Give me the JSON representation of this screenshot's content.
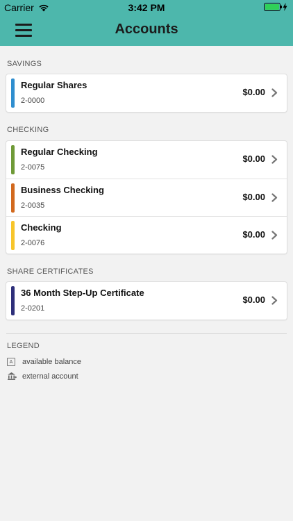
{
  "status_bar": {
    "carrier": "Carrier",
    "time": "3:42 PM"
  },
  "header": {
    "title": "Accounts",
    "menu_icon": "hamburger-icon"
  },
  "sections": [
    {
      "label": "SAVINGS",
      "accounts": [
        {
          "name": "Regular Shares",
          "number": "2-0000",
          "balance": "$0.00",
          "color": "#2f8ecf"
        }
      ]
    },
    {
      "label": "CHECKING",
      "accounts": [
        {
          "name": "Regular Checking",
          "number": "2-0075",
          "balance": "$0.00",
          "color": "#6f9a37"
        },
        {
          "name": "Business Checking",
          "number": "2-0035",
          "balance": "$0.00",
          "color": "#d2691e"
        },
        {
          "name": "Checking",
          "number": "2-0076",
          "balance": "$0.00",
          "color": "#f7c52b"
        }
      ]
    },
    {
      "label": "SHARE CERTIFICATES",
      "accounts": [
        {
          "name": "36 Month Step-Up Certificate",
          "number": "2-0201",
          "balance": "$0.00",
          "color": "#2e2f7a"
        }
      ]
    }
  ],
  "legend": {
    "label": "LEGEND",
    "items": [
      {
        "icon": "available-balance-icon",
        "glyph": "A",
        "text": "available balance"
      },
      {
        "icon": "bank-icon",
        "text": "external account"
      }
    ]
  },
  "colors": {
    "header_bg": "#4db7ac",
    "page_bg": "#f2f2f2"
  }
}
